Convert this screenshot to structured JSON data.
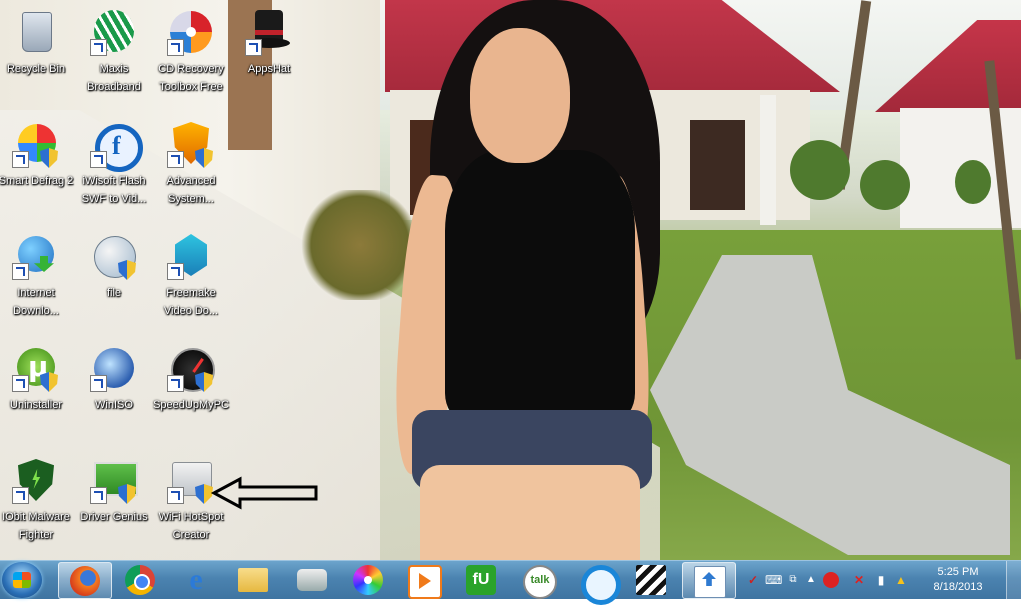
{
  "desktop": {
    "icons": [
      {
        "label": "Recycle Bin",
        "icon": "recycle-bin-icon"
      },
      {
        "label": "Maxis\nBroadband",
        "icon": "maxis-broadband-icon"
      },
      {
        "label": "CD Recovery\nToolbox Free",
        "icon": "cd-recovery-icon"
      },
      {
        "label": "AppsHat",
        "icon": "appshat-icon"
      },
      {
        "label": "Smart Defrag 2",
        "icon": "smart-defrag-icon"
      },
      {
        "label": "iWisoft Flash\nSWF to Vid...",
        "icon": "flash-swf-icon"
      },
      {
        "label": "Advanced\nSystem...",
        "icon": "advanced-system-icon"
      },
      {
        "label": "Internet\nDownlo...",
        "icon": "internet-download-icon"
      },
      {
        "label": "file",
        "icon": "file-globe-icon"
      },
      {
        "label": "Freemake\nVideo Do...",
        "icon": "freemake-icon"
      },
      {
        "label": "Uninstaller",
        "icon": "uninstaller-icon"
      },
      {
        "label": "WinISO",
        "icon": "winiso-icon"
      },
      {
        "label": "SpeedUpMyPC",
        "icon": "speedupmypc-icon"
      },
      {
        "label": "IObit Malware\nFighter",
        "icon": "iobit-malware-icon"
      },
      {
        "label": "Driver Genius",
        "icon": "driver-genius-icon"
      },
      {
        "label": "WiFi HotSpot\nCreator",
        "icon": "wifi-hotspot-icon"
      }
    ]
  },
  "taskbar": {
    "pinned": [
      {
        "name": "firefox",
        "icon": "firefox-icon"
      },
      {
        "name": "chrome",
        "icon": "chrome-icon"
      },
      {
        "name": "internet-explorer",
        "icon": "internet-explorer-icon"
      },
      {
        "name": "windows-explorer",
        "icon": "folder-icon"
      },
      {
        "name": "camera-app",
        "icon": "camera-icon"
      },
      {
        "name": "disc-app",
        "icon": "disc-icon"
      },
      {
        "name": "media-player",
        "icon": "media-player-icon"
      },
      {
        "name": "fu-app",
        "icon": "fu-icon"
      },
      {
        "name": "google-talk",
        "icon": "talk-icon",
        "text": "talk"
      },
      {
        "name": "c-app",
        "icon": "c-app-icon"
      },
      {
        "name": "movie-maker",
        "icon": "clapperboard-icon"
      },
      {
        "name": "upload-app",
        "icon": "upload-icon"
      }
    ],
    "ie_glyph": "e",
    "fu_glyph": "fU",
    "clock": {
      "time": "5:25 PM",
      "date": "8/18/2013"
    }
  },
  "colors": {
    "taskbar_top": "#6ca4cc",
    "taskbar_bottom": "#3f74a1",
    "label_text": "#ffffff"
  }
}
